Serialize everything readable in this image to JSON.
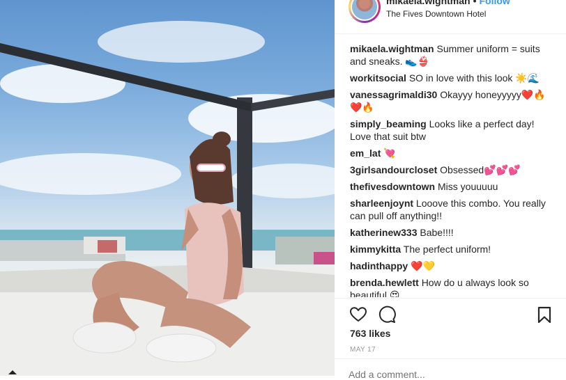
{
  "post": {
    "username": "mikaela.wightman",
    "separator": "•",
    "follow_label": "Follow",
    "location": "The Fives Downtown Hotel"
  },
  "comments": [
    {
      "user": "mikaela.wightman",
      "text": "Summer uniform = suits and sneaks. 👟👙"
    },
    {
      "user": "workitsocial",
      "text": "SO in love with this look ☀️🌊"
    },
    {
      "user": "vanessagrimaldi30",
      "text": "Okayyy honeyyyyy❤️🔥❤️🔥"
    },
    {
      "user": "simply_beaming",
      "text": "Looks like a perfect day! Love that suit btw"
    },
    {
      "user": "em_lat",
      "text": "💘"
    },
    {
      "user": "3girlsandourcloset",
      "text": "Obsessed💕💕💕"
    },
    {
      "user": "thefivesdowntown",
      "text": "Miss youuuuu"
    },
    {
      "user": "sharleenjoynt",
      "text": "Looove this combo. You really can pull off anything!!"
    },
    {
      "user": "katherinew333",
      "text": "Babe!!!!"
    },
    {
      "user": "kimmykitta",
      "text": "The perfect uniform!"
    },
    {
      "user": "hadinthappy",
      "text": "❤️💛"
    },
    {
      "user": "brenda.hewlett",
      "text": "How do u always look so beautiful 😍"
    }
  ],
  "actions": {
    "like_icon": "heart-icon",
    "comment_icon": "comment-bubble-icon",
    "save_icon": "bookmark-icon"
  },
  "likes": "763 likes",
  "date": "MAY 17",
  "add_comment_placeholder": "Add a comment...",
  "colors": {
    "link_blue": "#3897f0",
    "text": "#262626",
    "muted": "#999999",
    "border": "#efefef"
  }
}
